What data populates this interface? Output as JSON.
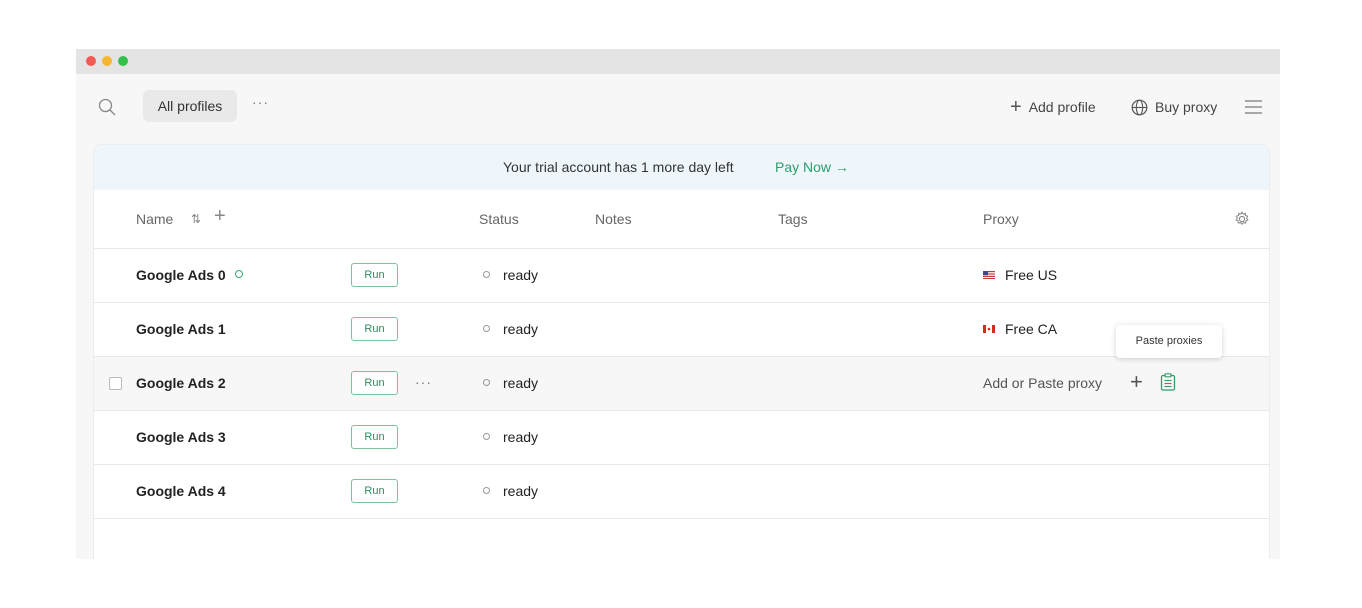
{
  "toolbar": {
    "tab_label": "All profiles",
    "more_label": "···",
    "add_profile_plus": "+",
    "add_profile_label": "Add profile",
    "buy_proxy_label": "Buy proxy"
  },
  "banner": {
    "message": "Your trial account has 1 more day left",
    "pay_now": "Pay Now →"
  },
  "table": {
    "columns": {
      "name": "Name",
      "sort": "⇅",
      "add": "+",
      "status": "Status",
      "notes": "Notes",
      "tags": "Tags",
      "proxy": "Proxy"
    },
    "rows": [
      {
        "name": "Google Ads 0",
        "run": "Run",
        "status": "ready",
        "proxy": "Free US"
      },
      {
        "name": "Google Ads 1",
        "run": "Run",
        "status": "ready",
        "proxy": "Free CA"
      },
      {
        "name": "Google Ads 2",
        "run": "Run",
        "more": "···",
        "status": "ready",
        "proxy_placeholder": "Add or Paste proxy",
        "plus": "+"
      },
      {
        "name": "Google Ads 3",
        "run": "Run",
        "status": "ready"
      },
      {
        "name": "Google Ads 4",
        "run": "Run",
        "status": "ready"
      }
    ]
  },
  "tooltip": "Paste proxies",
  "icons": [
    "search-icon",
    "globe-icon",
    "menu-icon",
    "settings-icon",
    "us-flag-icon",
    "ca-flag-icon",
    "clipboard-icon"
  ],
  "colors": {
    "accent": "#2e9d6a",
    "banner_bg": "#eef6fb"
  }
}
